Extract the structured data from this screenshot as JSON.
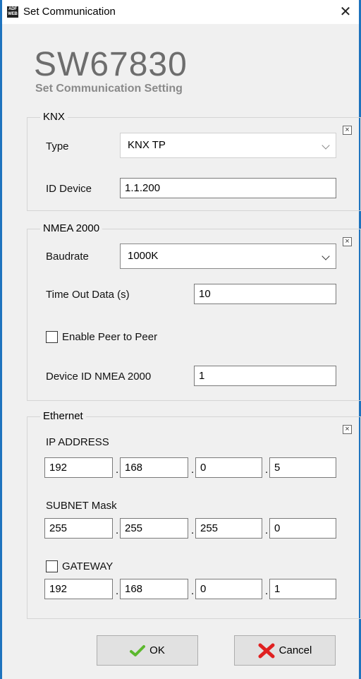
{
  "window": {
    "title": "Set Communication",
    "icon_text": "ADF WEB"
  },
  "logo": {
    "model": "SW67830",
    "subtitle": "Set Communication Setting"
  },
  "knx": {
    "legend": "KNX",
    "type_label": "Type",
    "type_value": "KNX TP",
    "id_label": "ID Device",
    "id_value": "1.1.200"
  },
  "nmea": {
    "legend": "NMEA 2000",
    "baudrate_label": "Baudrate",
    "baudrate_value": "1000K",
    "timeout_label": "Time Out Data (s)",
    "timeout_value": "10",
    "peer_label": "Enable Peer to Peer",
    "peer_checked": false,
    "device_id_label": "Device ID NMEA 2000",
    "device_id_value": "1"
  },
  "ethernet": {
    "legend": "Ethernet",
    "ip_label": "IP ADDRESS",
    "ip": [
      "192",
      "168",
      "0",
      "5"
    ],
    "subnet_label": "SUBNET Mask",
    "subnet": [
      "255",
      "255",
      "255",
      "0"
    ],
    "gateway_label": "GATEWAY",
    "gateway_checked": false,
    "gateway": [
      "192",
      "168",
      "0",
      "1"
    ]
  },
  "buttons": {
    "ok": "OK",
    "cancel": "Cancel"
  },
  "colors": {
    "window_border": "#1e73be",
    "ok_check": "#5cb82e",
    "cancel_x": "#e02020"
  }
}
